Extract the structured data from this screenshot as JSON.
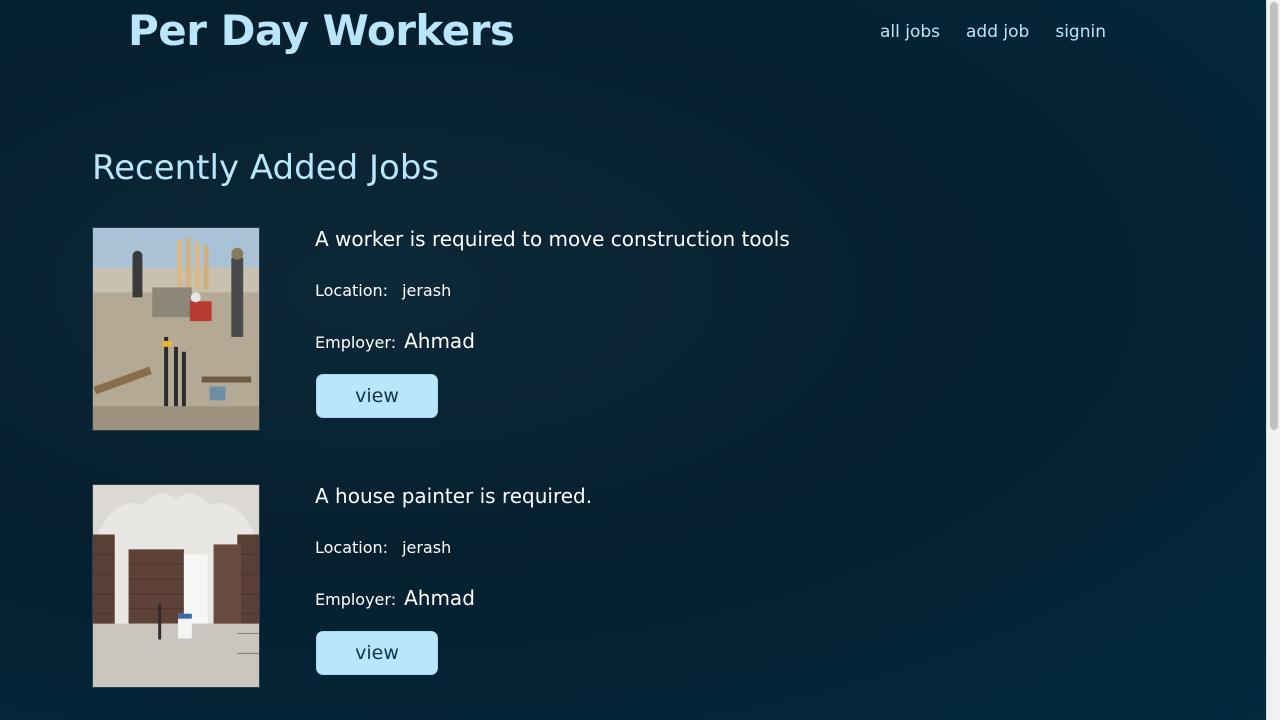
{
  "header": {
    "brand": "Per Day Workers",
    "nav": [
      {
        "label": "all jobs"
      },
      {
        "label": "add job"
      },
      {
        "label": "signin"
      }
    ]
  },
  "main": {
    "section_title": "Recently Added Jobs",
    "jobs": [
      {
        "title": "A worker is required to move construction tools",
        "location_label": "Location:",
        "location": "jerash",
        "employer_label": "Employer:",
        "employer": "Ahmad",
        "button_label": "view",
        "image": "construction-site-photo"
      },
      {
        "title": "A house painter is required.",
        "location_label": "Location:",
        "location": "jerash",
        "employer_label": "Employer:",
        "employer": "Ahmad",
        "button_label": "view",
        "image": "house-interior-photo"
      }
    ]
  },
  "colors": {
    "accent": "#b9e6fb",
    "background": "#04222f",
    "button_text": "#123446"
  }
}
